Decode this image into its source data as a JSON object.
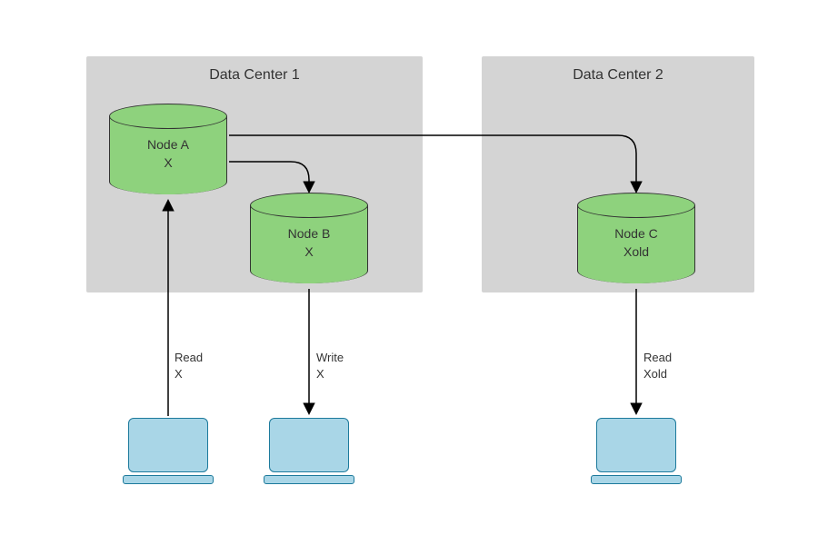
{
  "datacenters": {
    "dc1": {
      "title": "Data Center 1"
    },
    "dc2": {
      "title": "Data Center 2"
    }
  },
  "nodes": {
    "a": {
      "name": "Node A",
      "value": "X"
    },
    "b": {
      "name": "Node B",
      "value": "X"
    },
    "c": {
      "name": "Node C",
      "value": "Xold"
    }
  },
  "edges": {
    "readX": {
      "op": "Read",
      "value": "X"
    },
    "writeX": {
      "op": "Write",
      "value": "X"
    },
    "readOld": {
      "op": "Read",
      "value": "Xold"
    }
  }
}
